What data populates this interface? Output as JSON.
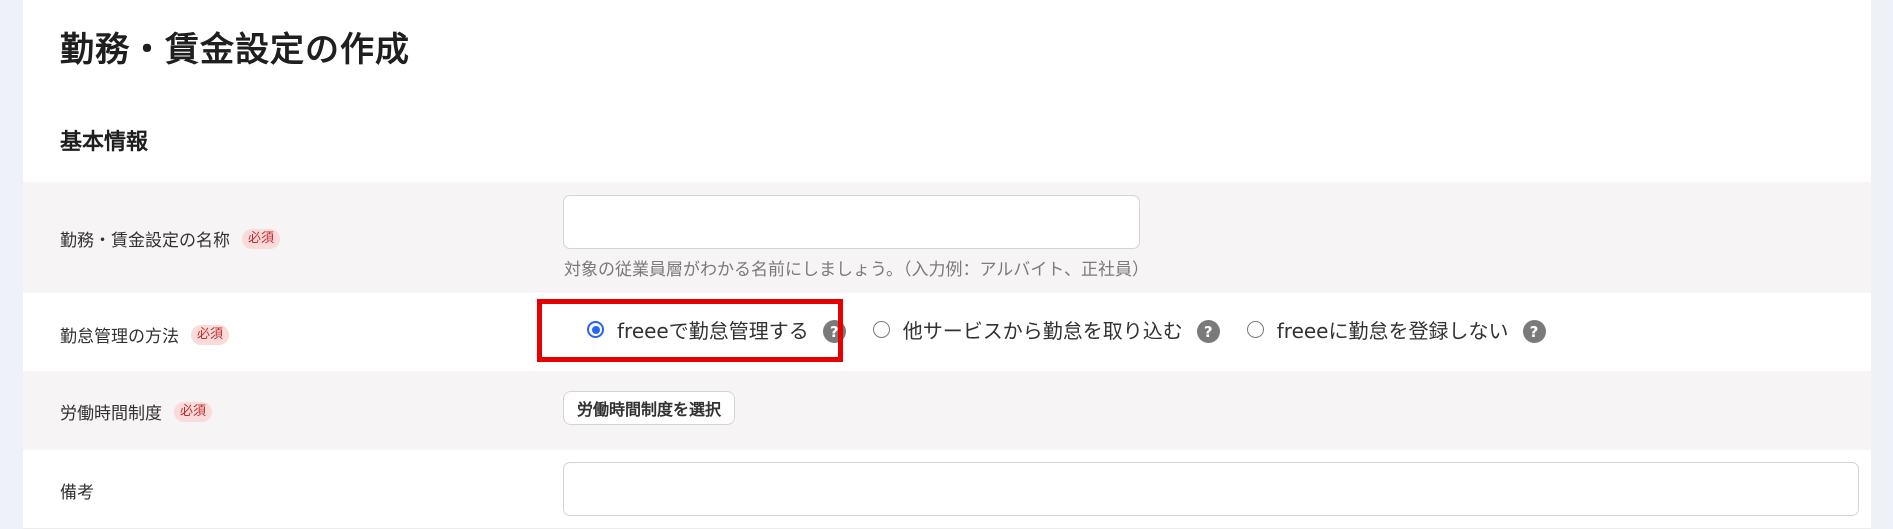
{
  "page": {
    "title": "勤務・賃金設定の作成",
    "section_title": "基本情報"
  },
  "form": {
    "required_label": "必須",
    "name_field": {
      "label": "勤務・賃金設定の名称",
      "value": "",
      "hint": "対象の従業員層がわかる名前にしましょう。（入力例：アルバイト、正社員）"
    },
    "attendance_method": {
      "label": "勤怠管理の方法",
      "options": [
        {
          "label": "freeeで勤怠管理する",
          "selected": true
        },
        {
          "label": "他サービスから勤怠を取り込む",
          "selected": false
        },
        {
          "label": "freeeに勤怠を登録しない",
          "selected": false
        }
      ],
      "help_glyph": "?"
    },
    "working_hours_system": {
      "label": "労働時間制度",
      "button_label": "労働時間制度を選択"
    },
    "remarks": {
      "label": "備考",
      "value": ""
    }
  },
  "colors": {
    "highlight": "#e60000",
    "radio_accent": "#2864f0",
    "required_bg": "#fbdada",
    "required_text": "#c02c2c"
  }
}
